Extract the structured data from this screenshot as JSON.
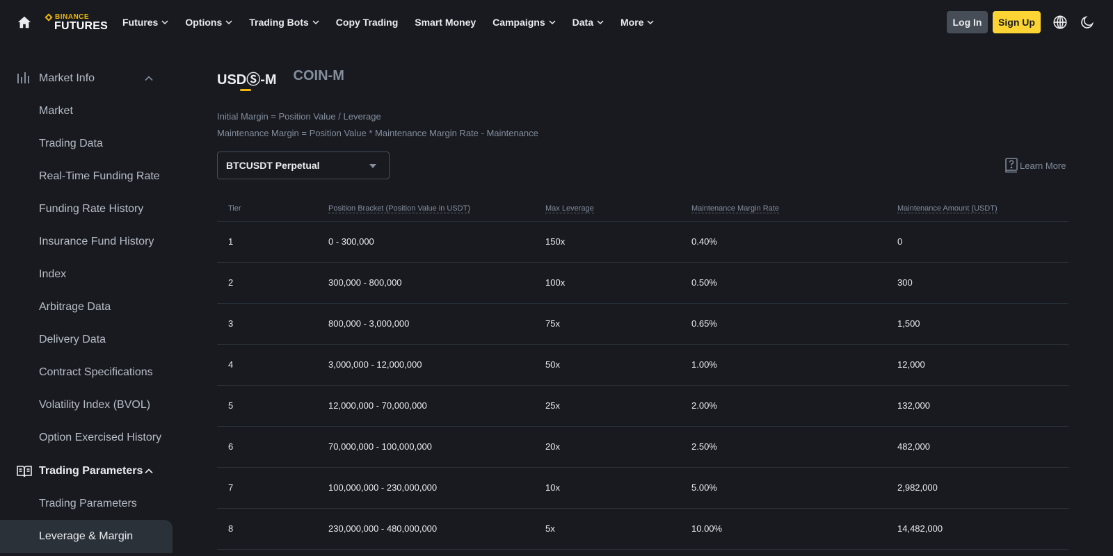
{
  "nav": {
    "logo_top": "BINANCE",
    "logo_bottom": "FUTURES",
    "items": [
      {
        "label": "Futures",
        "dropdown": true
      },
      {
        "label": "Options",
        "dropdown": true
      },
      {
        "label": "Trading Bots",
        "dropdown": true
      },
      {
        "label": "Copy Trading",
        "dropdown": false
      },
      {
        "label": "Smart Money",
        "dropdown": false
      },
      {
        "label": "Campaigns",
        "dropdown": true
      },
      {
        "label": "Data",
        "dropdown": true
      },
      {
        "label": "More",
        "dropdown": true
      }
    ],
    "login_label": "Log In",
    "signup_label": "Sign Up"
  },
  "sidebar": {
    "market_info": {
      "label": "Market Info",
      "items": [
        "Market",
        "Trading Data",
        "Real-Time Funding Rate",
        "Funding Rate History",
        "Insurance Fund History",
        "Index",
        "Arbitrage Data",
        "Delivery Data",
        "Contract Specifications",
        "Volatility Index (BVOL)",
        "Option Exercised History"
      ]
    },
    "trading_parameters": {
      "label": "Trading Parameters",
      "items": [
        "Trading Parameters",
        "Leverage & Margin"
      ],
      "active_item": "Leverage & Margin"
    }
  },
  "main": {
    "tabs": [
      {
        "label": "USDⓈ-M",
        "active": true
      },
      {
        "label": "COIN-M",
        "active": false
      }
    ],
    "formula_initial": "Initial Margin = Position Value / Leverage",
    "formula_maintenance": "Maintenance Margin = Position Value * Maintenance Margin Rate - Maintenance",
    "symbol_select": "BTCUSDT Perpetual",
    "learn_more": "Learn More",
    "table": {
      "headers": [
        "Tier",
        "Position Bracket (Position Value in USDT)",
        "Max Leverage",
        "Maintenance Margin Rate",
        "Maintenance Amount (USDT)"
      ],
      "rows": [
        [
          "1",
          "0 - 300,000",
          "150x",
          "0.40%",
          "0"
        ],
        [
          "2",
          "300,000 - 800,000",
          "100x",
          "0.50%",
          "300"
        ],
        [
          "3",
          "800,000 - 3,000,000",
          "75x",
          "0.65%",
          "1,500"
        ],
        [
          "4",
          "3,000,000 - 12,000,000",
          "50x",
          "1.00%",
          "12,000"
        ],
        [
          "5",
          "12,000,000 - 70,000,000",
          "25x",
          "2.00%",
          "132,000"
        ],
        [
          "6",
          "70,000,000 - 100,000,000",
          "20x",
          "2.50%",
          "482,000"
        ],
        [
          "7",
          "100,000,000 - 230,000,000",
          "10x",
          "5.00%",
          "2,982,000"
        ],
        [
          "8",
          "230,000,000 - 480,000,000",
          "5x",
          "10.00%",
          "14,482,000"
        ]
      ]
    }
  },
  "colors": {
    "background": "#181a20",
    "accent": "#f0b90b",
    "signup": "#fcd535",
    "muted_text": "#848e9c",
    "divider": "#2b3139"
  }
}
